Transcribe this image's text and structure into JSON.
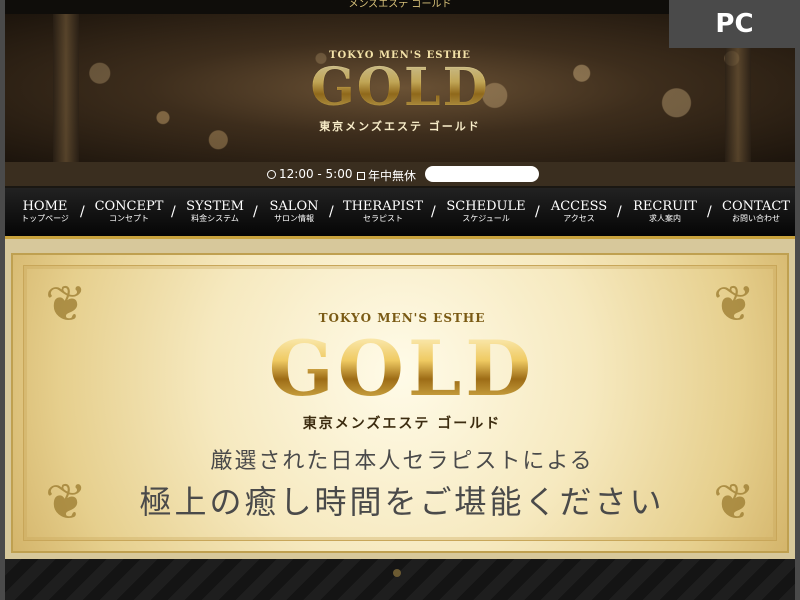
{
  "badge": "PC",
  "top_strip_text": "メンズエステ ゴールド",
  "header": {
    "brand_en": "TOKYO MEN'S ESTHE",
    "logo": "GOLD",
    "brand_jp": "東京メンズエステ ゴールド"
  },
  "info": {
    "hours": "12:00 - 5:00",
    "holiday": "年中無休",
    "search_value": ""
  },
  "nav": [
    {
      "en": "HOME",
      "jp": "トップページ"
    },
    {
      "en": "CONCEPT",
      "jp": "コンセプト"
    },
    {
      "en": "SYSTEM",
      "jp": "料金システム"
    },
    {
      "en": "SALON",
      "jp": "サロン情報"
    },
    {
      "en": "THERAPIST",
      "jp": "セラピスト"
    },
    {
      "en": "SCHEDULE",
      "jp": "スケジュール"
    },
    {
      "en": "ACCESS",
      "jp": "アクセス"
    },
    {
      "en": "RECRUIT",
      "jp": "求人案内"
    },
    {
      "en": "CONTACT",
      "jp": "お問い合わせ"
    }
  ],
  "banner": {
    "brand_en": "TOKYO MEN'S ESTHE",
    "logo": "GOLD",
    "brand_jp": "東京メンズエステ ゴールド",
    "line1": "厳選された日本人セラピストによる",
    "line2": "極上の癒し時間をご堪能ください"
  },
  "colors": {
    "gold": "#c9a23c",
    "nav_bg": "#111111",
    "badge_bg": "#4a4a4a"
  }
}
